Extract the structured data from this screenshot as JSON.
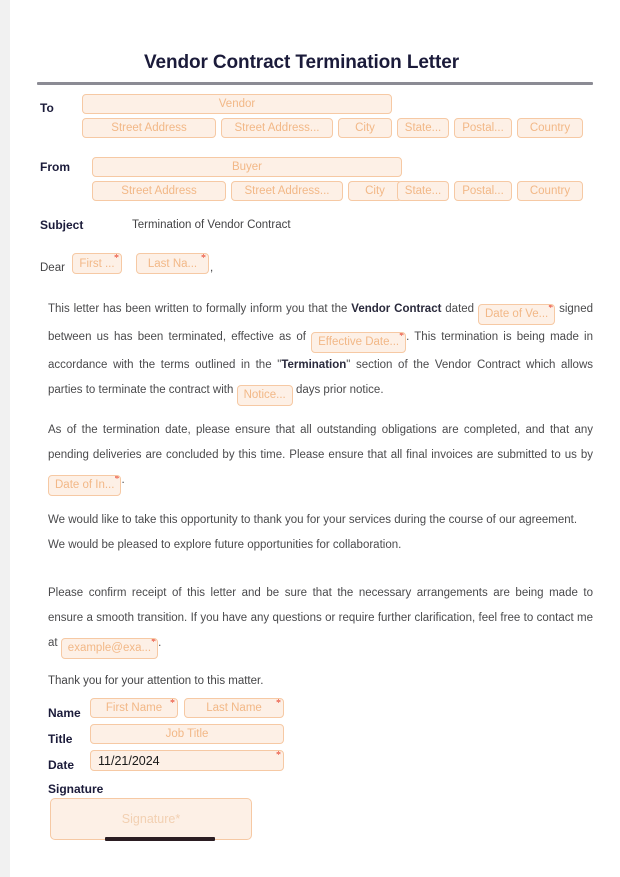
{
  "document": {
    "title": "Vendor Contract Termination Letter"
  },
  "to_block": {
    "label": "To",
    "company_placeholder": "Vendor",
    "address": [
      "Street Address",
      "Street Address...",
      "City",
      "State...",
      "Postal...",
      "Country"
    ]
  },
  "from_block": {
    "label": "From",
    "company_placeholder": "Buyer",
    "address": [
      "Street Address",
      "Street Address...",
      "City",
      "State...",
      "Postal...",
      "Country"
    ]
  },
  "subject": {
    "label": "Subject",
    "value": "Termination of Vendor Contract"
  },
  "salutation": {
    "greeting": "Dear",
    "first_name_placeholder": "First ...",
    "last_name_placeholder": "Last Na...",
    "comma": ","
  },
  "paragraph1": {
    "part1": "This letter has been written to formally inform you that the ",
    "bold1": "Vendor Contract",
    "part2": " dated ",
    "field_date_of_vendor": "Date of Ve...",
    "part3": " signed between us has been terminated, effective as of ",
    "field_effective_date": "Effective Date...",
    "part4": ". This termination is being made in accordance with the terms outlined in the \"",
    "bold2": "Termination",
    "part5": "\" section of the Vendor Contract which allows parties to terminate the contract with ",
    "field_notice": "Notice...",
    "part6": " days prior notice."
  },
  "paragraph2": {
    "part1": "As of the termination date, please ensure that all outstanding obligations are completed, and that any pending deliveries are concluded by this time. Please ensure that all final invoices are submitted to us by ",
    "field_date_of_invoice": "Date of In...",
    "part2": "."
  },
  "paragraph3": {
    "text": "We would like to take this opportunity to thank you for your services during the course of our agreement. We would be pleased to explore future opportunities for collaboration."
  },
  "paragraph4": {
    "part1": "Please confirm receipt of this letter and be sure that the necessary arrangements are being made to ensure a smooth transition. If you have any questions or require further clarification, feel free to contact me at ",
    "field_email": "example@exa...",
    "part2": "."
  },
  "closing": {
    "thanks": "Thank you for your attention to this matter."
  },
  "signer": {
    "name_label": "Name",
    "first_name_placeholder": "First Name",
    "last_name_placeholder": "Last Name",
    "title_label": "Title",
    "job_title_placeholder": "Job Title",
    "date_label": "Date",
    "date_value": "11/21/2024",
    "signature_label": "Signature",
    "signature_placeholder": "Signature"
  },
  "markers": {
    "required": "*"
  },
  "colors": {
    "field_fill": "#fdf0e6",
    "field_border": "#f6c9a4",
    "placeholder_text": "#f2b887",
    "required_star": "#e8402a",
    "title_text": "#1b1b3a",
    "body_text": "#4a4a4c",
    "rule": "#8b8b94",
    "signature_bar": "#2b1d22"
  }
}
